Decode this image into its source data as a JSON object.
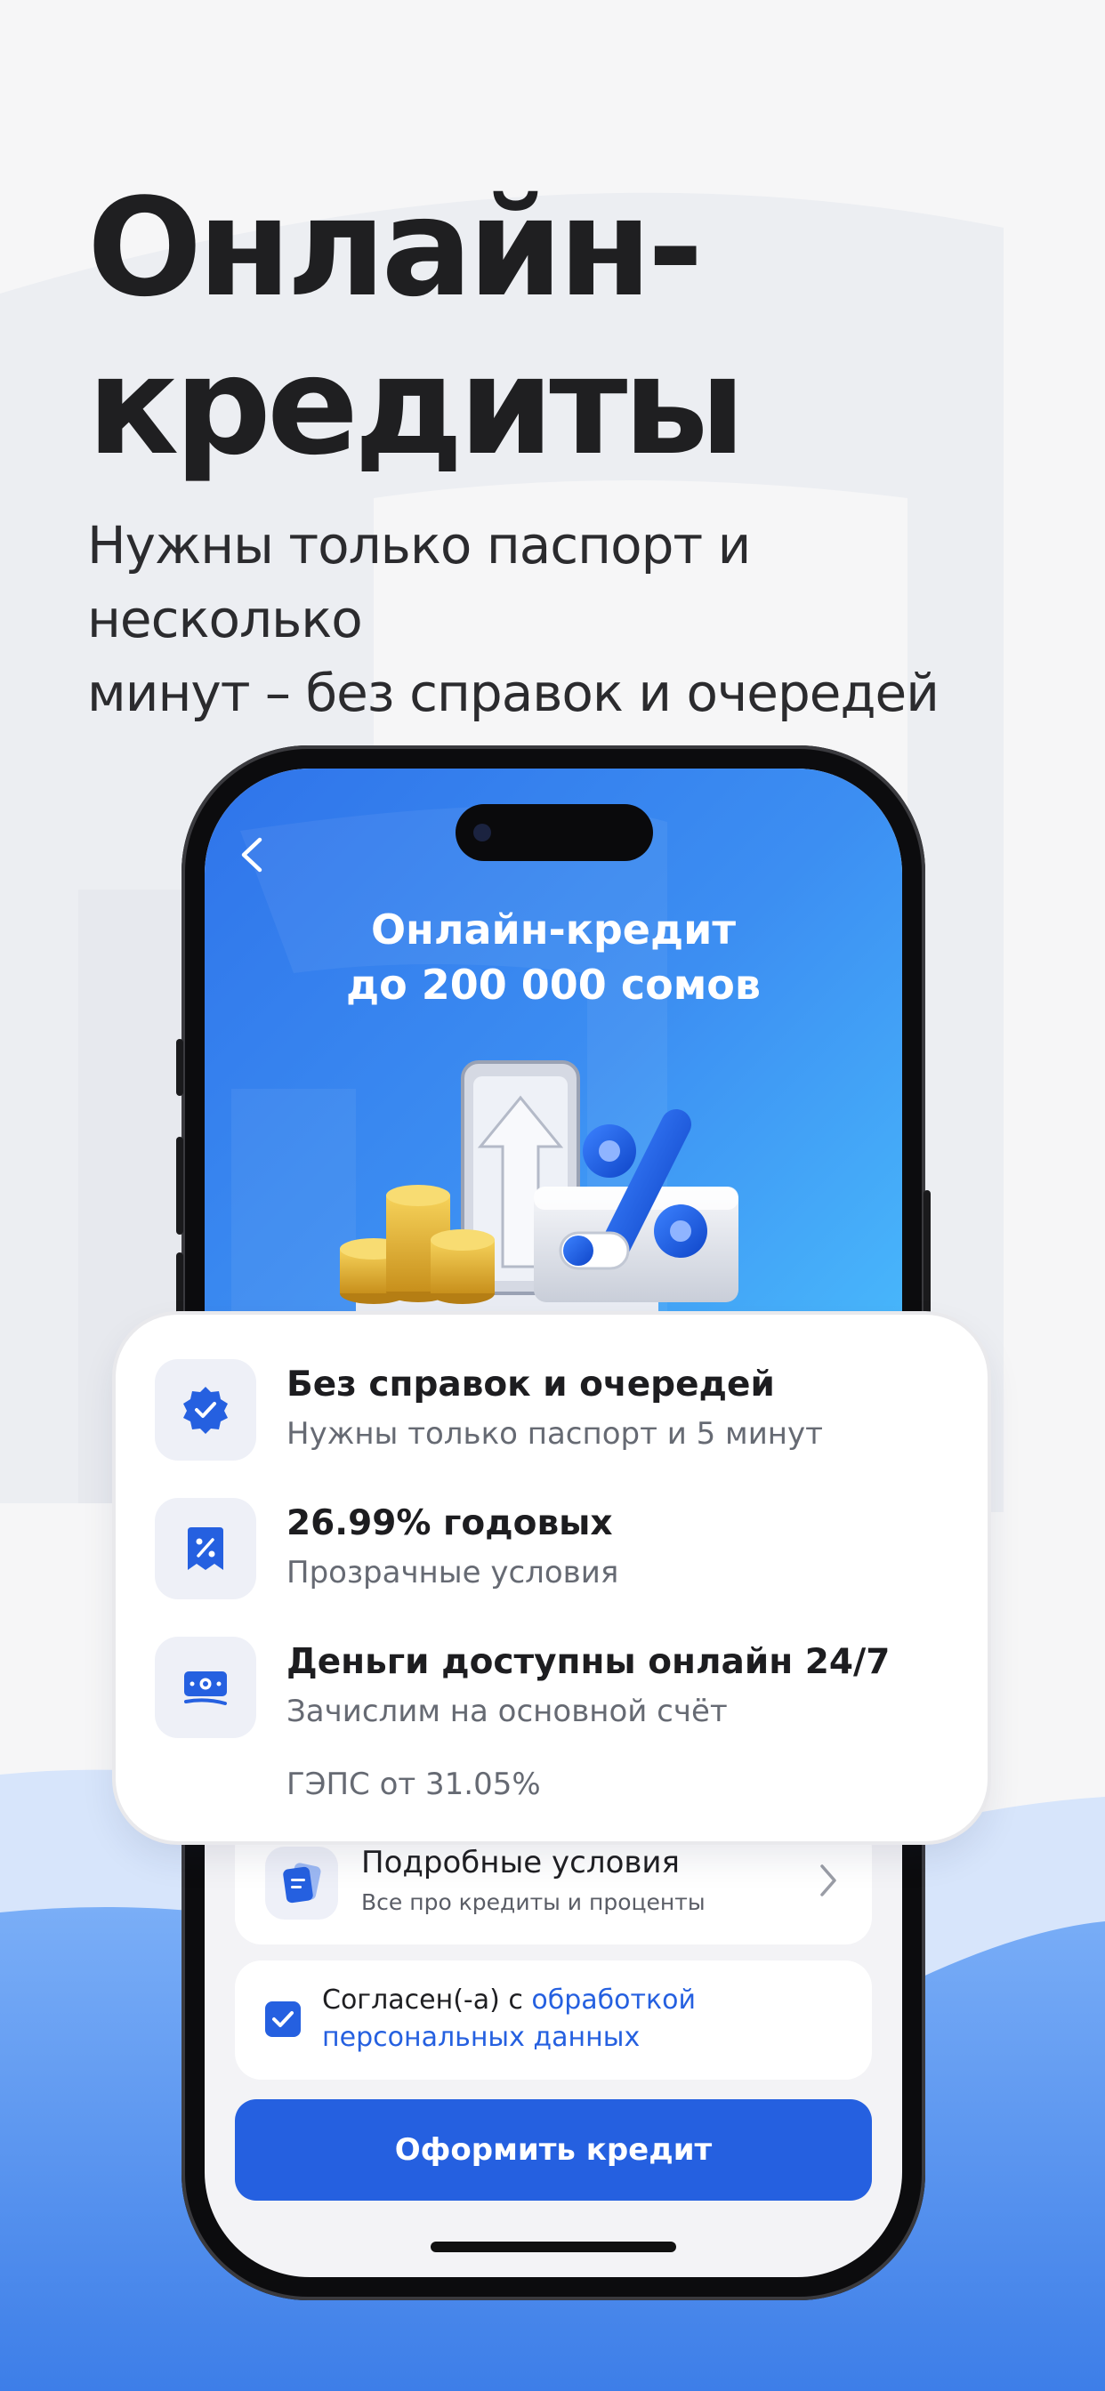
{
  "hero": {
    "title_line1": "Онлайн-",
    "title_line2": "кредиты",
    "subtitle_line1": "Нужны только паспорт и несколько",
    "subtitle_line2": "минут – без справок и очередей"
  },
  "phone_screen": {
    "back_icon": "chevron-left-icon",
    "title_line1": "Онлайн-кредит",
    "title_line2": "до 200 000 сомов",
    "terms_row": {
      "icon": "document-icon",
      "title": "Подробные условия",
      "subtitle": "Все про кредиты и проценты",
      "chevron_icon": "chevron-right-icon"
    },
    "consent": {
      "checked": true,
      "text": "Согласен(-а) с ",
      "link_line1": "обработкой",
      "link_line2": "персональных данных"
    },
    "cta_label": "Оформить кредит"
  },
  "feature_card": {
    "features": [
      {
        "icon": "verified-badge-icon",
        "title": "Без справок и очередей",
        "subtitle": "Нужны только паспорт и 5 минут"
      },
      {
        "icon": "percent-receipt-icon",
        "title": "26.99% годовых",
        "subtitle": "Прозрачные условия"
      },
      {
        "icon": "banknote-icon",
        "title": "Деньги доступны онлайн 24/7",
        "subtitle": "Зачислим на основной счёт"
      }
    ],
    "gaps_note": "ГЭПС от 31.05%"
  },
  "colors": {
    "accent": "#2560e0",
    "hero_text": "#1f1f21",
    "screen_gradient_start": "#2f74ea",
    "screen_gradient_end": "#48b6fb"
  }
}
